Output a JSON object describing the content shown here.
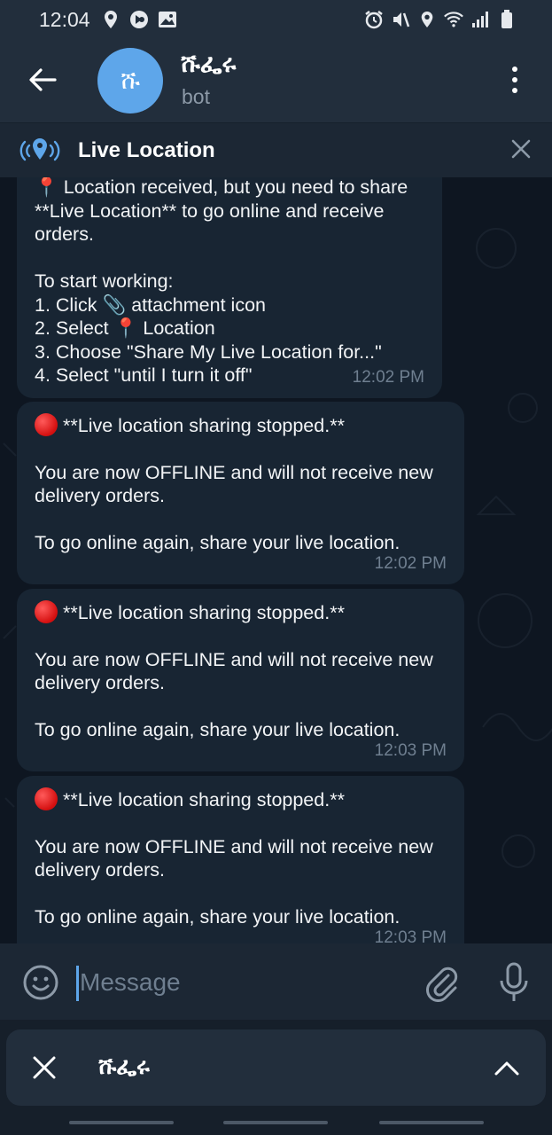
{
  "status_bar": {
    "time": "12:04",
    "left_icons": [
      "location-icon",
      "vpn-icon",
      "image-icon"
    ],
    "right_icons": [
      "alarm-icon",
      "mute-icon",
      "location-icon",
      "wifi-icon",
      "signal-icon",
      "battery-icon"
    ]
  },
  "header": {
    "back_icon": "arrow-left-icon",
    "avatar_text": "ሹ",
    "title": "ሹፌሩ",
    "subtitle": "bot",
    "menu_icon": "more-vertical-icon"
  },
  "live_bar": {
    "label": "Live Location",
    "icon": "live-location-icon",
    "close_icon": "close-icon"
  },
  "messages": [
    {
      "text": "📍 Location received, but you need to share **Live Location** to go online and receive orders.\n\nTo start working:\n1. Click 📎 attachment icon\n2. Select 📍 Location\n3. Choose \"Share My Live Location for...\"\n4. Select \"until I turn it off\"",
      "time": "12:02 PM"
    },
    {
      "title": "**Live location sharing stopped.**",
      "body": "You are now OFFLINE and will not receive new delivery orders.\n\nTo go online again, share your live location.",
      "time": "12:02 PM"
    },
    {
      "title": "**Live location sharing stopped.**",
      "body": "You are now OFFLINE and will not receive new delivery orders.\n\nTo go online again, share your live location.",
      "time": "12:03 PM"
    },
    {
      "title": "**Live location sharing stopped.**",
      "body": "You are now OFFLINE and will not receive new delivery orders.\n\nTo go online again, share your live location.",
      "time": "12:03 PM"
    }
  ],
  "composer": {
    "placeholder": "Message",
    "emoji_icon": "emoji-icon",
    "attach_icon": "paperclip-icon",
    "mic_icon": "microphone-icon"
  },
  "bot_panel": {
    "title": "ሹፌሩ",
    "close_icon": "close-icon",
    "chevron_icon": "chevron-up-icon"
  },
  "colors": {
    "header_bg": "#222e3c",
    "chat_bg": "#0e1621",
    "bubble_bg": "#182533",
    "accent": "#5ea6ea",
    "muted_text": "#6f7f90"
  }
}
